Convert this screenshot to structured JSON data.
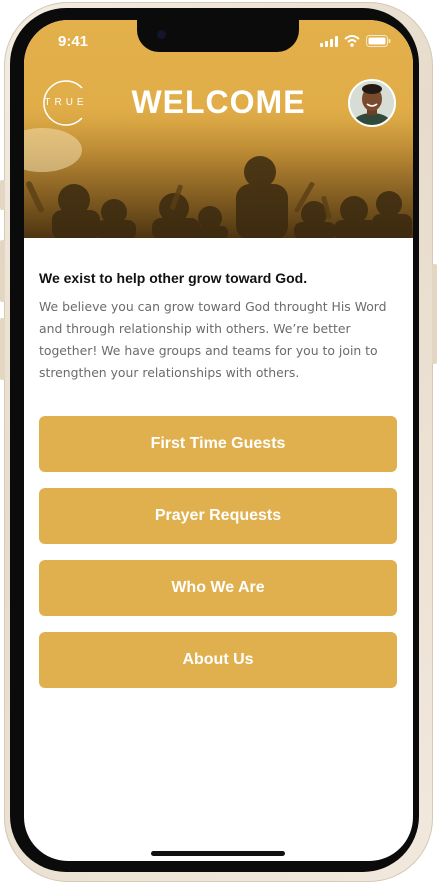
{
  "status_bar": {
    "time": "9:41"
  },
  "header": {
    "logo_text": "TRUE",
    "title": "WELCOME",
    "profile_icon": "avatar-photo",
    "accent_color": "#e0b04e"
  },
  "intro": {
    "heading": "We exist to help other grow toward God.",
    "body": "We believe you can grow toward God throught His Word and through relationship with others. We’re better together! We have groups and teams for you to join to strengthen your relationships with others."
  },
  "menu": [
    {
      "label": "First Time Guests"
    },
    {
      "label": "Prayer Requests"
    },
    {
      "label": "Who We Are"
    },
    {
      "label": "About Us"
    }
  ]
}
